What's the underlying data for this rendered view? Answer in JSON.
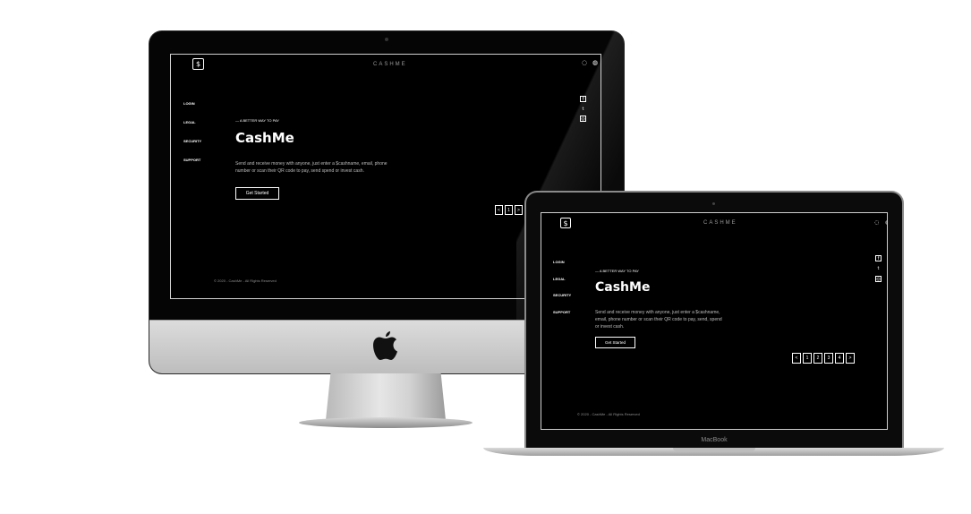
{
  "site": {
    "logo_symbol": "$",
    "brand": "CASHME",
    "top_icons": [
      "◌",
      "◍"
    ],
    "nav": [
      "LOGIN",
      "LEGAL",
      "SECURITY",
      "SUPPORT"
    ],
    "social_icons": [
      "f",
      "t",
      "◎"
    ],
    "tagline": "— A BETTER WAY TO PAY",
    "title": "CashMe",
    "imac_description": "Send and receive money with anyone, just enter a $cashname, email, phone number or scan their QR code to pay, send spend or invest cash.",
    "macbook_description": "Send and receive money with anyone, just enter a $cashname, email, phone number or scan their QR code to pay, send, spend or invest cash.",
    "cta": "Get Started",
    "imac_pager": [
      "<",
      "1",
      ">"
    ],
    "macbook_pager": [
      "<",
      "1",
      "2",
      "3",
      "4",
      ">"
    ],
    "footer": "© 2020 - CashMe - All Rights Reserved"
  },
  "devices": {
    "laptop_label": "MacBook"
  },
  "colors": {
    "screen_bg": "#000000",
    "text": "#ffffff",
    "muted": "#9a9a9a"
  },
  "icons": {
    "device_logo": "apple-logo-icon"
  }
}
